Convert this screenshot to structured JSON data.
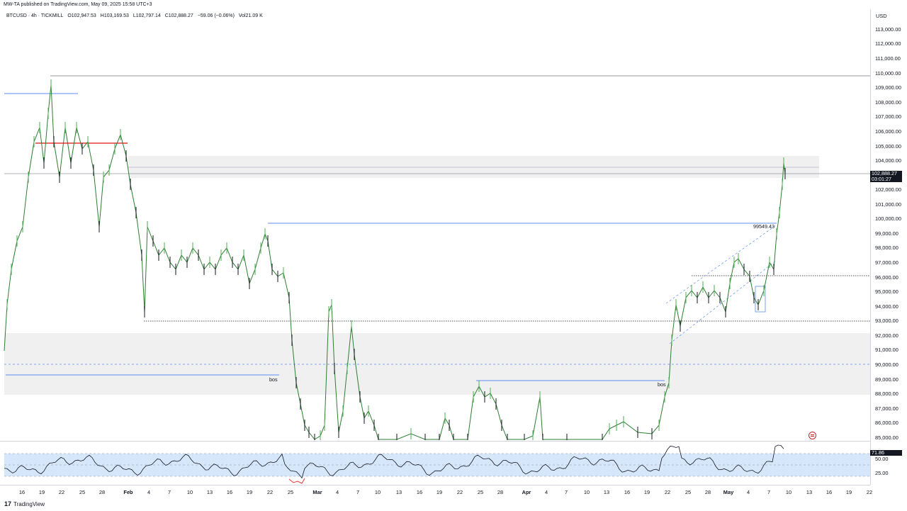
{
  "header": {
    "published": "MW-TA published on TradingView.com, May 09, 2025 15:58 UTC+3"
  },
  "legend": {
    "symbol": "BTCUSD · 4h · TICKMILL",
    "open": "O102,947.53",
    "high": "H103,169.53",
    "low": "L102,797.14",
    "close": "C102,888.27",
    "change": "−59.06 (−0.06%)",
    "volume": "Vol21.09 K"
  },
  "price_axis": {
    "currency": "USD",
    "ticks": [
      "113,000.00",
      "112,000.00",
      "111,000.00",
      "110,000.00",
      "109,000.00",
      "108,000.00",
      "107,000.00",
      "106,000.00",
      "105,000.00",
      "104,000.00",
      "102,000.00",
      "101,000.00",
      "100,000.00",
      "99,000.00",
      "98,000.00",
      "97,000.00",
      "96,000.00",
      "95,000.00",
      "94,000.00",
      "93,000.00",
      "92,000.00",
      "91,000.00",
      "90,000.00",
      "89,000.00",
      "88,000.00",
      "87,000.00",
      "86,000.00",
      "85,000.00"
    ],
    "last_price": "102,888.27",
    "countdown": "03:01:27"
  },
  "rsi_axis": {
    "ticks": [
      "50.00",
      "25.00"
    ],
    "value": "71.86"
  },
  "time_axis": {
    "ticks": [
      "16",
      "19",
      "22",
      "25",
      "28",
      "Feb",
      "4",
      "7",
      "10",
      "13",
      "16",
      "19",
      "22",
      "25",
      "Mar",
      "4",
      "7",
      "10",
      "13",
      "16",
      "19",
      "22",
      "25",
      "28",
      "Apr",
      "4",
      "7",
      "10",
      "13",
      "16",
      "19",
      "22",
      "25",
      "28",
      "May",
      "4",
      "7",
      "10",
      "13",
      "16",
      "19",
      "22"
    ]
  },
  "annotations": {
    "level_label": "99549.43",
    "bos_1": "bos",
    "bos_2": "bos"
  },
  "footer": {
    "brand": "TradingView",
    "logo": "17"
  },
  "colors": {
    "up": "#4caf50",
    "down": "#131722",
    "blue_line": "#5b8def",
    "red_line": "#e53935",
    "zone": "#f0f0f0",
    "rsi_band": "#d6e6fb"
  },
  "icons": {
    "flag": "us-flag-event-icon",
    "logo": "tradingview-logo-icon"
  }
}
